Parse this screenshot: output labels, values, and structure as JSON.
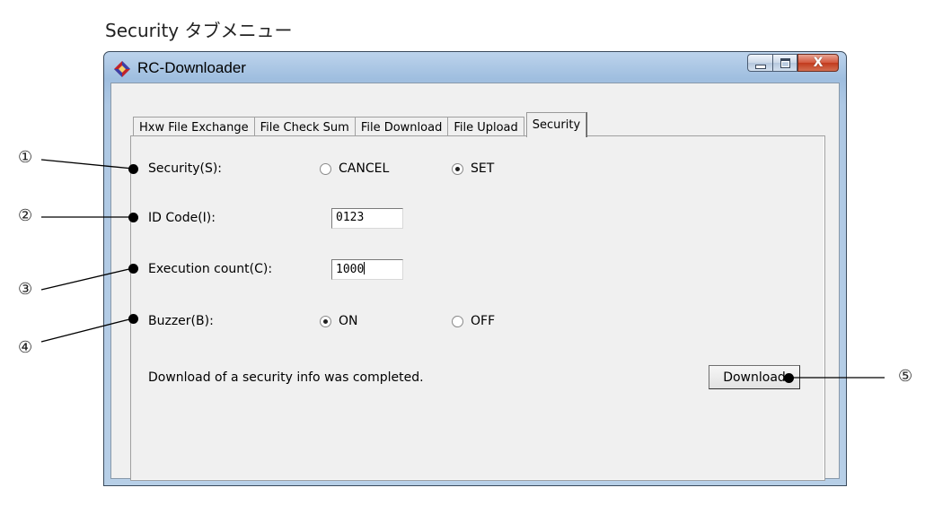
{
  "page_caption": "Security タブメニュー",
  "window": {
    "title": "RC-Downloader",
    "buttons": {
      "minimize": "minimize",
      "maximize": "maximize",
      "close": "X"
    }
  },
  "tabs": [
    {
      "label": "Hxw File Exchange",
      "active": false
    },
    {
      "label": "File Check Sum",
      "active": false
    },
    {
      "label": "File Download",
      "active": false
    },
    {
      "label": "File Upload",
      "active": false
    },
    {
      "label": "Security",
      "active": true
    }
  ],
  "form": {
    "security": {
      "label": "Security(S):",
      "options": [
        {
          "label": "CANCEL",
          "checked": false
        },
        {
          "label": "SET",
          "checked": true
        }
      ]
    },
    "id_code": {
      "label": "ID Code(I):",
      "value": "0123"
    },
    "execution_count": {
      "label": "Execution count(C):",
      "value": "1000"
    },
    "buzzer": {
      "label": "Buzzer(B):",
      "options": [
        {
          "label": "ON",
          "checked": true
        },
        {
          "label": "OFF",
          "checked": false
        }
      ]
    },
    "status_message": "Download of a security info was completed.",
    "download_button": "Download"
  },
  "callouts": [
    "①",
    "②",
    "③",
    "④",
    "⑤"
  ]
}
